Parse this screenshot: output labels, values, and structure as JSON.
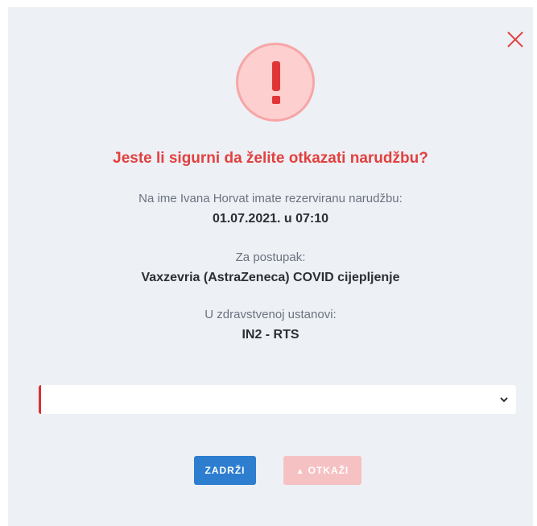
{
  "dialog": {
    "title": "Jeste li sigurni da želite otkazati narudžbu?",
    "reservation_intro": "Na ime Ivana Horvat imate rezerviranu narudžbu:",
    "reservation_datetime": "01.07.2021. u 07:10",
    "procedure_label": "Za postupak:",
    "procedure_value": "Vaxzevria (AstraZeneca) COVID cijepljenje",
    "institution_label": "U zdravstvenoj ustanovi:",
    "institution_value": "IN2 - RTS",
    "reason_select": {
      "selected_value": ""
    },
    "buttons": {
      "keep_label": "ZADRŽI",
      "cancel_label": "OTKAŽI"
    }
  },
  "icons": {
    "close": "close-icon",
    "alert": "exclamation-icon",
    "dropdown": "chevron-down-icon",
    "warning": "warning-icon"
  },
  "colors": {
    "backdrop": "#edf0f4",
    "title": "#e2403f",
    "alert_bg": "#fdcfcf",
    "alert_mark": "#e03535",
    "primary_button": "#2d7ecf",
    "danger_button_disabled": "#f6c1c3",
    "select_border": "#d93030"
  }
}
